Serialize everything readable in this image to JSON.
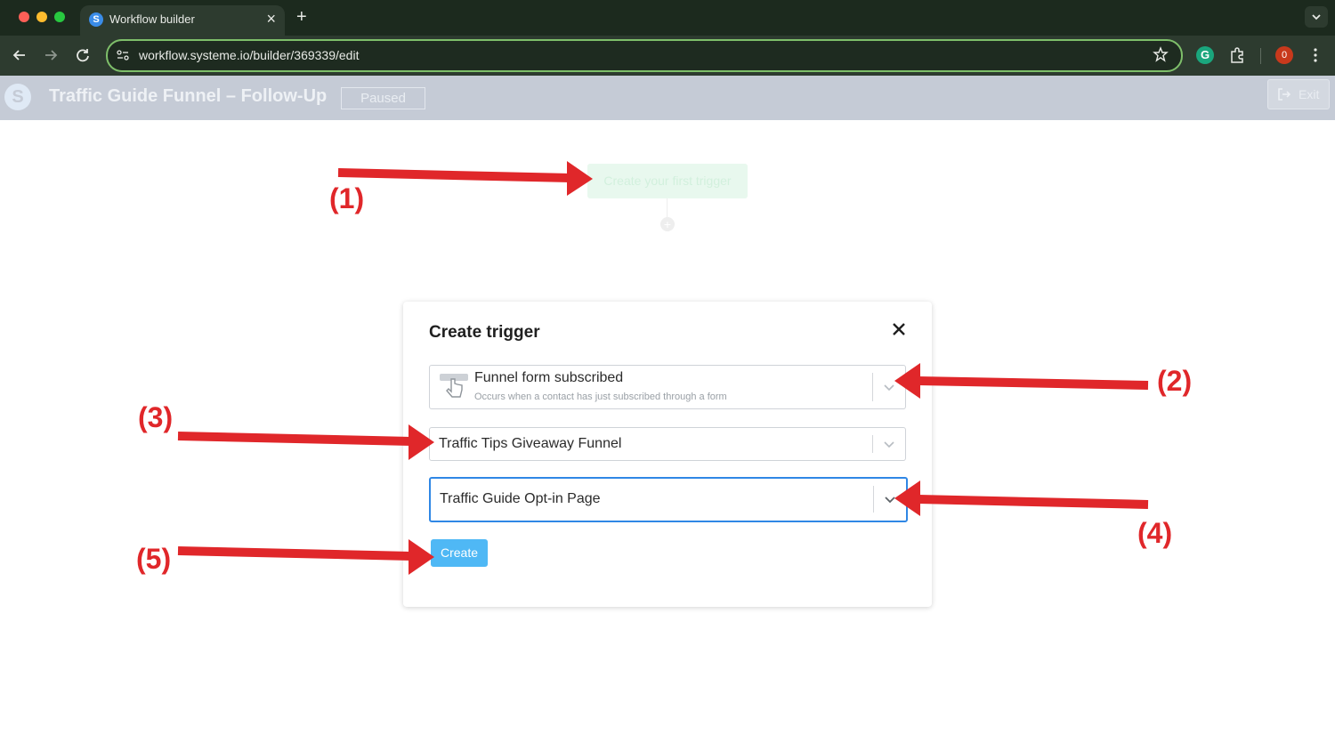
{
  "browser": {
    "tab_title": "Workflow builder",
    "tab_favicon_letter": "S",
    "url": "workflow.systeme.io/builder/369339/edit",
    "profile_badge": "0",
    "grammarly_letter": "G"
  },
  "app": {
    "logo_letter": "S",
    "workflow_name": "Traffic Guide Funnel – Follow-Up",
    "status": "Paused",
    "exit_label": "Exit"
  },
  "canvas": {
    "trigger_placeholder": "Create your first trigger",
    "add_step_symbol": "+"
  },
  "modal": {
    "title": "Create trigger",
    "trigger_type": {
      "title": "Funnel form subscribed",
      "description": "Occurs when a contact has just subscribed through a form"
    },
    "funnel_value": "Traffic Tips Giveaway Funnel",
    "page_value": "Traffic Guide Opt-in Page",
    "create_label": "Create"
  },
  "annotations": {
    "step1": "(1)",
    "step2": "(2)",
    "step3": "(3)",
    "step4": "(4)",
    "step5": "(5)",
    "arrow_color": "#e0272a"
  },
  "colors": {
    "accent": "#4fb8f5",
    "focus_border": "#2f87e5",
    "omnibox_border": "#7ebf6a"
  }
}
